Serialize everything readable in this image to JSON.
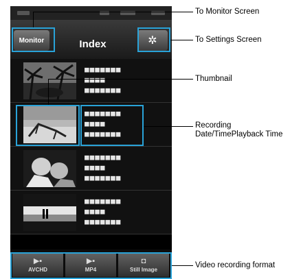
{
  "app": {
    "header": {
      "monitor_button": "Monitor",
      "title": "Index",
      "settings_icon": "gear-icon"
    },
    "rows": [
      {
        "thumbnail": "palm-trees-thumbnail",
        "line1": "■■■■■■■",
        "line2": "■■■■",
        "line3": "■■■■■■■"
      },
      {
        "thumbnail": "beach-chair-thumbnail",
        "line1": "■■■■■■■",
        "line2": "■■■■",
        "line3": "■■■■■■■"
      },
      {
        "thumbnail": "children-thumbnail",
        "line1": "■■■■■■■",
        "line2": "■■■■",
        "line3": "■■■■■■■"
      },
      {
        "thumbnail": "sunset-beach-thumbnail",
        "line1": "■■■■■■■",
        "line2": "■■■■",
        "line3": "■■■■■■■"
      }
    ],
    "tabs": [
      {
        "label": "AVCHD",
        "icon": "video-camera-icon"
      },
      {
        "label": "MP4",
        "icon": "video-camera-icon"
      },
      {
        "label": "Still Image",
        "icon": "camera-icon"
      }
    ]
  },
  "callouts": {
    "monitor": "To Monitor Screen",
    "settings": "To Settings Screen",
    "thumbnail": "Thumbnail",
    "recording_line1": "Recording",
    "recording_line2": "Date/TimePlayback Time",
    "format": "Video recording format"
  },
  "colors": {
    "highlight": "#29a3d9",
    "background": "#000000"
  }
}
